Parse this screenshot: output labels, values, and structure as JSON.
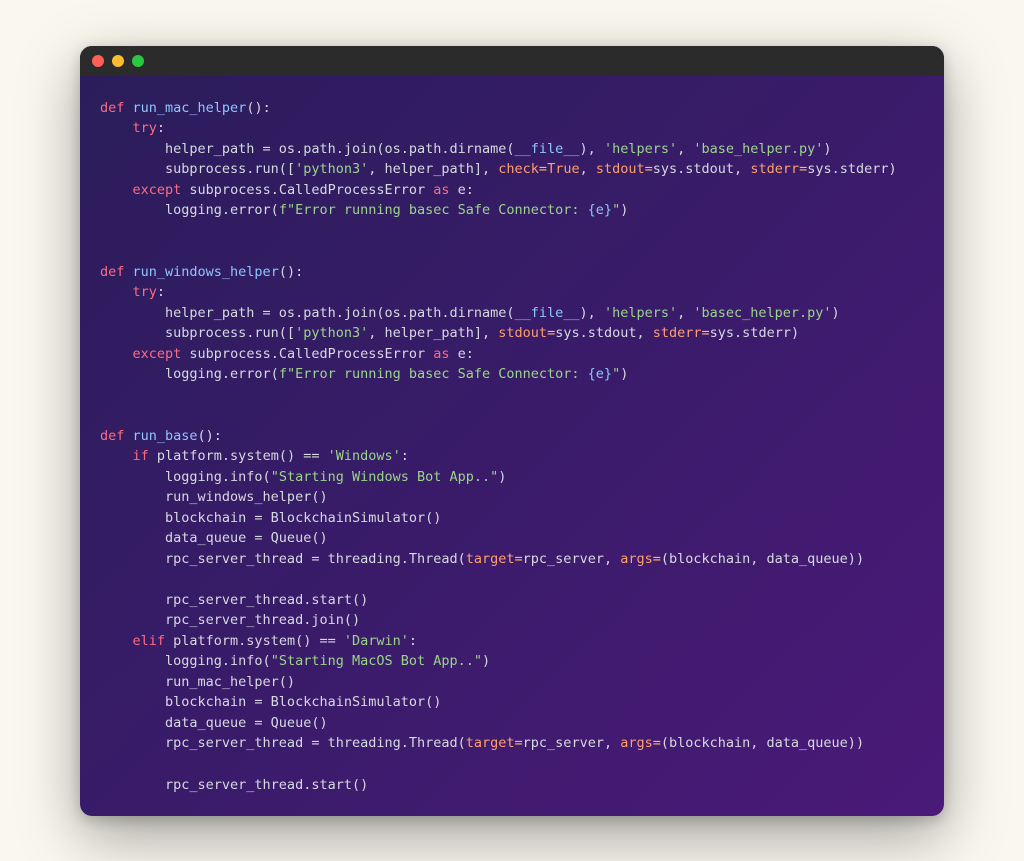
{
  "window": {
    "traffic_lights": {
      "red": "close",
      "yellow": "minimize",
      "green": "zoom"
    }
  },
  "code": {
    "l01_def": "def",
    "l01_fn": " run_mac_helper",
    "l01_rest": "():",
    "l02_try": "try",
    "l02_colon": ":",
    "l03_lead": "        helper_path = os.path.join(os.path.dirname(",
    "l03_file": "__file__",
    "l03_mid1": "), ",
    "l03_s1": "'helpers'",
    "l03_mid2": ", ",
    "l03_s2": "'base_helper.py'",
    "l03_end": ")",
    "l04_lead": "        subprocess.run([",
    "l04_s1": "'python3'",
    "l04_mid1": ", helper_path], ",
    "l04_k1": "check",
    "l04_eq1": "=",
    "l04_true": "True",
    "l04_mid2": ", ",
    "l04_k2": "stdout",
    "l04_eq2": "=",
    "l04_v2": "sys.stdout, ",
    "l04_k3": "stderr",
    "l04_eq3": "=",
    "l04_v3": "sys.stderr)",
    "l05_except": "except",
    "l05_mid": " subprocess.CalledProcessError ",
    "l05_as": "as",
    "l05_e": " e:",
    "l06_lead": "        logging.error(",
    "l06_f": "f\"Error running basec Safe Connector: ",
    "l06_brace": "{e}",
    "l06_end": "\"",
    "l06_paren": ")",
    "l08_def": "def",
    "l08_fn": " run_windows_helper",
    "l08_rest": "():",
    "l09_try": "try",
    "l09_colon": ":",
    "l10_lead": "        helper_path = os.path.join(os.path.dirname(",
    "l10_file": "__file__",
    "l10_mid1": "), ",
    "l10_s1": "'helpers'",
    "l10_mid2": ", ",
    "l10_s2": "'basec_helper.py'",
    "l10_end": ")",
    "l11_lead": "        subprocess.run([",
    "l11_s1": "'python3'",
    "l11_mid1": ", helper_path], ",
    "l11_k2": "stdout",
    "l11_eq2": "=",
    "l11_v2": "sys.stdout, ",
    "l11_k3": "stderr",
    "l11_eq3": "=",
    "l11_v3": "sys.stderr)",
    "l12_except": "except",
    "l12_mid": " subprocess.CalledProcessError ",
    "l12_as": "as",
    "l12_e": " e:",
    "l13_lead": "        logging.error(",
    "l13_f": "f\"Error running basec Safe Connector: ",
    "l13_brace": "{e}",
    "l13_end": "\"",
    "l13_paren": ")",
    "l15_def": "def",
    "l15_fn": " run_base",
    "l15_rest": "():",
    "l16_if": "if",
    "l16_mid": " platform.system() == ",
    "l16_s": "'Windows'",
    "l16_colon": ":",
    "l17_lead": "        logging.info(",
    "l17_s": "\"Starting Windows Bot App..\"",
    "l17_end": ")",
    "l18": "        run_windows_helper()",
    "l19": "        blockchain = BlockchainSimulator()",
    "l20": "        data_queue = Queue()",
    "l21_lead": "        rpc_server_thread = threading.Thread(",
    "l21_k1": "target",
    "l21_eq1": "=",
    "l21_v1": "rpc_server, ",
    "l21_k2": "args",
    "l21_eq2": "=",
    "l21_v2": "(blockchain, data_queue))",
    "l23": "        rpc_server_thread.start()",
    "l24": "        rpc_server_thread.join()",
    "l25_elif": "elif",
    "l25_mid": " platform.system() == ",
    "l25_s": "'Darwin'",
    "l25_colon": ":",
    "l26_lead": "        logging.info(",
    "l26_s": "\"Starting MacOS Bot App..\"",
    "l26_end": ")",
    "l27": "        run_mac_helper()",
    "l28": "        blockchain = BlockchainSimulator()",
    "l29": "        data_queue = Queue()",
    "l30_lead": "        rpc_server_thread = threading.Thread(",
    "l30_k1": "target",
    "l30_eq1": "=",
    "l30_v1": "rpc_server, ",
    "l30_k2": "args",
    "l30_eq2": "=",
    "l30_v2": "(blockchain, data_queue))",
    "l32": "        rpc_server_thread.start()"
  }
}
